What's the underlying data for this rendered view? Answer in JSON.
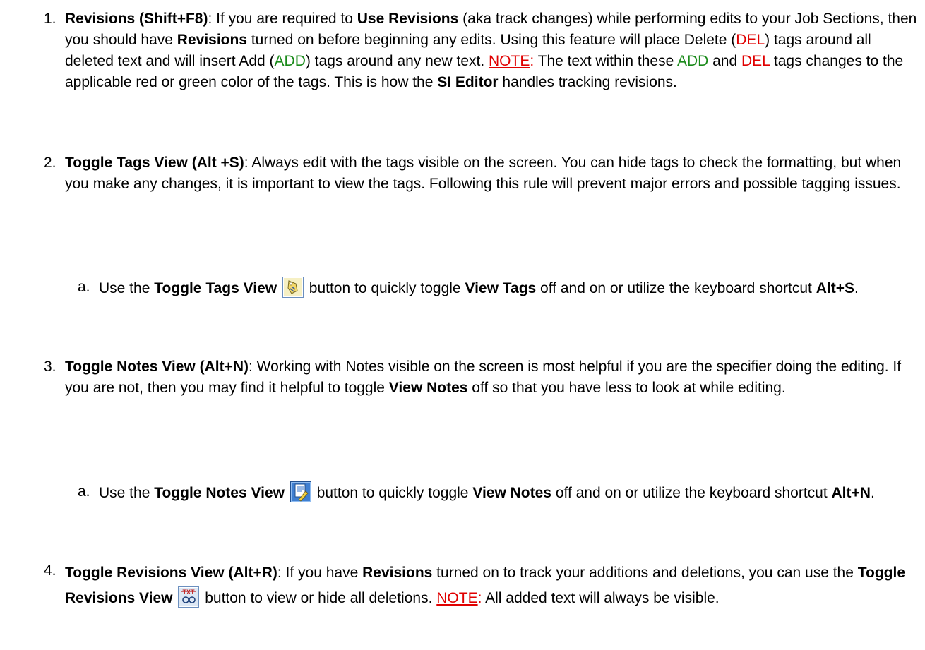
{
  "items": [
    {
      "num": "1.",
      "title": "Revisions (Shift+F8)",
      "t1": ": If you are required to ",
      "b1": "Use Revisions",
      "t2": " (aka track changes) while performing edits to your Job Sections, then you should have ",
      "b2": "Revisions",
      "t3": " turned on before beginning any edits. Using this feature will place Delete (",
      "del1": "DEL",
      "t4": ") tags around all deleted text and will insert Add (",
      "add1": "ADD",
      "t5": ") tags around any new text. ",
      "note": "NOTE",
      "note_colon": ":",
      "t6": " The text within these ",
      "add2": "ADD",
      "t7": " and ",
      "del2": "DEL",
      "t8": " tags changes to the applicable red or green color of the tags. This is how the ",
      "b3": "SI Editor",
      "t9": " handles tracking revisions."
    },
    {
      "num": "2.",
      "title": "Toggle Tags View (Alt +S)",
      "t1": ": Always edit with the tags visible on the screen. You can hide tags to check the formatting, but when you make any changes, it is important to view the tags. Following this rule will prevent major errors and possible tagging issues.",
      "sub": {
        "letter": "a.",
        "t1": "Use the ",
        "b1": "Toggle Tags View",
        "icon": "toggle-tags-icon",
        "t2": " button to quickly toggle ",
        "b2": "View Tags",
        "t3": " off and on or utilize the keyboard shortcut ",
        "b3": "Alt+S",
        "t4": "."
      }
    },
    {
      "num": "3.",
      "title": "Toggle Notes View (Alt+N)",
      "t1": ": Working with Notes visible on the screen is most helpful if you are the specifier doing the editing. If you are not, then you may find it helpful to toggle ",
      "b1": "View Notes",
      "t2": " off so that you have less to look at while editing.",
      "sub": {
        "letter": "a.",
        "t1": "Use the ",
        "b1": "Toggle Notes View",
        "icon": "toggle-notes-icon",
        "t2": " button to quickly toggle ",
        "b2": "View Notes",
        "t3": " off and on or utilize the keyboard shortcut ",
        "b3": "Alt+N",
        "t4": "."
      }
    },
    {
      "num": "4.",
      "title": "Toggle Revisions View (Alt+R)",
      "t1": ": If you have ",
      "b1": "Revisions",
      "t2": " turned on to track your additions and deletions, you can use the ",
      "b2": "Toggle Revisions View",
      "icon": "toggle-revisions-icon",
      "t3": " button to view or hide all deletions. ",
      "note": "NOTE",
      "note_colon": ":",
      "t4": " All added text will always be visible."
    }
  ],
  "colors": {
    "del": "#e00000",
    "add": "#1a8a1a",
    "note": "#e00000"
  }
}
